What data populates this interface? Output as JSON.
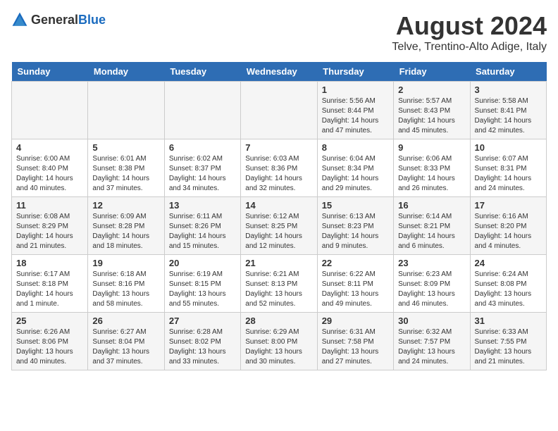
{
  "logo": {
    "general": "General",
    "blue": "Blue"
  },
  "title": "August 2024",
  "location": "Telve, Trentino-Alto Adige, Italy",
  "days_of_week": [
    "Sunday",
    "Monday",
    "Tuesday",
    "Wednesday",
    "Thursday",
    "Friday",
    "Saturday"
  ],
  "weeks": [
    [
      {
        "day": "",
        "info": ""
      },
      {
        "day": "",
        "info": ""
      },
      {
        "day": "",
        "info": ""
      },
      {
        "day": "",
        "info": ""
      },
      {
        "day": "1",
        "info": "Sunrise: 5:56 AM\nSunset: 8:44 PM\nDaylight: 14 hours and 47 minutes."
      },
      {
        "day": "2",
        "info": "Sunrise: 5:57 AM\nSunset: 8:43 PM\nDaylight: 14 hours and 45 minutes."
      },
      {
        "day": "3",
        "info": "Sunrise: 5:58 AM\nSunset: 8:41 PM\nDaylight: 14 hours and 42 minutes."
      }
    ],
    [
      {
        "day": "4",
        "info": "Sunrise: 6:00 AM\nSunset: 8:40 PM\nDaylight: 14 hours and 40 minutes."
      },
      {
        "day": "5",
        "info": "Sunrise: 6:01 AM\nSunset: 8:38 PM\nDaylight: 14 hours and 37 minutes."
      },
      {
        "day": "6",
        "info": "Sunrise: 6:02 AM\nSunset: 8:37 PM\nDaylight: 14 hours and 34 minutes."
      },
      {
        "day": "7",
        "info": "Sunrise: 6:03 AM\nSunset: 8:36 PM\nDaylight: 14 hours and 32 minutes."
      },
      {
        "day": "8",
        "info": "Sunrise: 6:04 AM\nSunset: 8:34 PM\nDaylight: 14 hours and 29 minutes."
      },
      {
        "day": "9",
        "info": "Sunrise: 6:06 AM\nSunset: 8:33 PM\nDaylight: 14 hours and 26 minutes."
      },
      {
        "day": "10",
        "info": "Sunrise: 6:07 AM\nSunset: 8:31 PM\nDaylight: 14 hours and 24 minutes."
      }
    ],
    [
      {
        "day": "11",
        "info": "Sunrise: 6:08 AM\nSunset: 8:29 PM\nDaylight: 14 hours and 21 minutes."
      },
      {
        "day": "12",
        "info": "Sunrise: 6:09 AM\nSunset: 8:28 PM\nDaylight: 14 hours and 18 minutes."
      },
      {
        "day": "13",
        "info": "Sunrise: 6:11 AM\nSunset: 8:26 PM\nDaylight: 14 hours and 15 minutes."
      },
      {
        "day": "14",
        "info": "Sunrise: 6:12 AM\nSunset: 8:25 PM\nDaylight: 14 hours and 12 minutes."
      },
      {
        "day": "15",
        "info": "Sunrise: 6:13 AM\nSunset: 8:23 PM\nDaylight: 14 hours and 9 minutes."
      },
      {
        "day": "16",
        "info": "Sunrise: 6:14 AM\nSunset: 8:21 PM\nDaylight: 14 hours and 6 minutes."
      },
      {
        "day": "17",
        "info": "Sunrise: 6:16 AM\nSunset: 8:20 PM\nDaylight: 14 hours and 4 minutes."
      }
    ],
    [
      {
        "day": "18",
        "info": "Sunrise: 6:17 AM\nSunset: 8:18 PM\nDaylight: 14 hours and 1 minute."
      },
      {
        "day": "19",
        "info": "Sunrise: 6:18 AM\nSunset: 8:16 PM\nDaylight: 13 hours and 58 minutes."
      },
      {
        "day": "20",
        "info": "Sunrise: 6:19 AM\nSunset: 8:15 PM\nDaylight: 13 hours and 55 minutes."
      },
      {
        "day": "21",
        "info": "Sunrise: 6:21 AM\nSunset: 8:13 PM\nDaylight: 13 hours and 52 minutes."
      },
      {
        "day": "22",
        "info": "Sunrise: 6:22 AM\nSunset: 8:11 PM\nDaylight: 13 hours and 49 minutes."
      },
      {
        "day": "23",
        "info": "Sunrise: 6:23 AM\nSunset: 8:09 PM\nDaylight: 13 hours and 46 minutes."
      },
      {
        "day": "24",
        "info": "Sunrise: 6:24 AM\nSunset: 8:08 PM\nDaylight: 13 hours and 43 minutes."
      }
    ],
    [
      {
        "day": "25",
        "info": "Sunrise: 6:26 AM\nSunset: 8:06 PM\nDaylight: 13 hours and 40 minutes."
      },
      {
        "day": "26",
        "info": "Sunrise: 6:27 AM\nSunset: 8:04 PM\nDaylight: 13 hours and 37 minutes."
      },
      {
        "day": "27",
        "info": "Sunrise: 6:28 AM\nSunset: 8:02 PM\nDaylight: 13 hours and 33 minutes."
      },
      {
        "day": "28",
        "info": "Sunrise: 6:29 AM\nSunset: 8:00 PM\nDaylight: 13 hours and 30 minutes."
      },
      {
        "day": "29",
        "info": "Sunrise: 6:31 AM\nSunset: 7:58 PM\nDaylight: 13 hours and 27 minutes."
      },
      {
        "day": "30",
        "info": "Sunrise: 6:32 AM\nSunset: 7:57 PM\nDaylight: 13 hours and 24 minutes."
      },
      {
        "day": "31",
        "info": "Sunrise: 6:33 AM\nSunset: 7:55 PM\nDaylight: 13 hours and 21 minutes."
      }
    ]
  ]
}
